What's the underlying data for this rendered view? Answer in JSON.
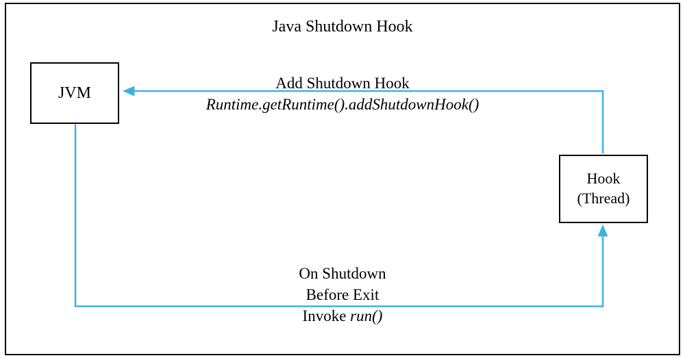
{
  "title": "Java Shutdown Hook",
  "jvm_box": "JVM",
  "hook_box_line1": "Hook",
  "hook_box_line2": "(Thread)",
  "top_arrow_label_line1": "Add Shutdown Hook",
  "top_arrow_label_line2": "Runtime.getRuntime().addShutdownHook()",
  "bottom_arrow_label_line1": "On Shutdown",
  "bottom_arrow_label_line2": "Before Exit",
  "bottom_arrow_label_line3_prefix": "Invoke ",
  "bottom_arrow_label_line3_italic": "run()",
  "colors": {
    "arrow": "#3db2e0"
  }
}
